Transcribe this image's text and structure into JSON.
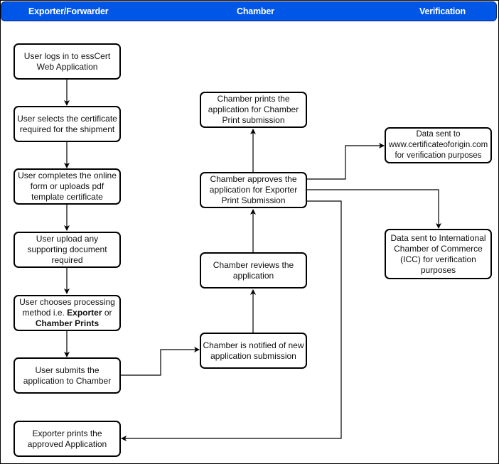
{
  "diagram": {
    "lanes": [
      {
        "id": "exporter",
        "title": "Exporter/Forwarder"
      },
      {
        "id": "chamber",
        "title": "Chamber"
      },
      {
        "id": "verification",
        "title": "Verification"
      }
    ],
    "header_color": "#0057e7",
    "nodes": {
      "login": {
        "lane": "exporter",
        "text": "User logs in to essCert Web Application"
      },
      "select_cert": {
        "lane": "exporter",
        "text": "User selects the certificate required for the shipment"
      },
      "complete_form": {
        "lane": "exporter",
        "text": "User completes the online form or uploads pdf template certificate"
      },
      "upload_docs": {
        "lane": "exporter",
        "text": "User upload any supporting document required"
      },
      "choose_method": {
        "lane": "exporter",
        "text_before": "User chooses processing method i.e. ",
        "bold1": "Exporter",
        "text_mid": " or ",
        "bold2": "Chamber Prints"
      },
      "submit": {
        "lane": "exporter",
        "text": "User submits the application to Chamber"
      },
      "exporter_prints": {
        "lane": "exporter",
        "text": "Exporter prints the approved Application"
      },
      "chamber_prints": {
        "lane": "chamber",
        "text": "Chamber prints the application for Chamber Print submission"
      },
      "chamber_approves": {
        "lane": "chamber",
        "text": "Chamber approves the application for Exporter Print Submission"
      },
      "chamber_reviews": {
        "lane": "chamber",
        "text": "Chamber reviews the application"
      },
      "chamber_notified": {
        "lane": "chamber",
        "text": "Chamber is notified of new application submission"
      },
      "data_coo": {
        "lane": "verification",
        "text": "Data sent to www.certificateoforigin.com for verification purposes"
      },
      "data_icc": {
        "lane": "verification",
        "text": "Data sent to International Chamber of Commerce (ICC) for verification purposes"
      }
    },
    "edges": [
      {
        "from": "login",
        "to": "select_cert"
      },
      {
        "from": "select_cert",
        "to": "complete_form"
      },
      {
        "from": "complete_form",
        "to": "upload_docs"
      },
      {
        "from": "upload_docs",
        "to": "choose_method"
      },
      {
        "from": "choose_method",
        "to": "submit"
      },
      {
        "from": "submit",
        "to": "chamber_notified"
      },
      {
        "from": "chamber_notified",
        "to": "chamber_reviews"
      },
      {
        "from": "chamber_reviews",
        "to": "chamber_approves"
      },
      {
        "from": "chamber_approves",
        "to": "chamber_prints"
      },
      {
        "from": "chamber_approves",
        "to": "data_coo"
      },
      {
        "from": "chamber_approves",
        "to": "data_icc"
      },
      {
        "from": "chamber_approves",
        "to": "exporter_prints"
      }
    ]
  }
}
